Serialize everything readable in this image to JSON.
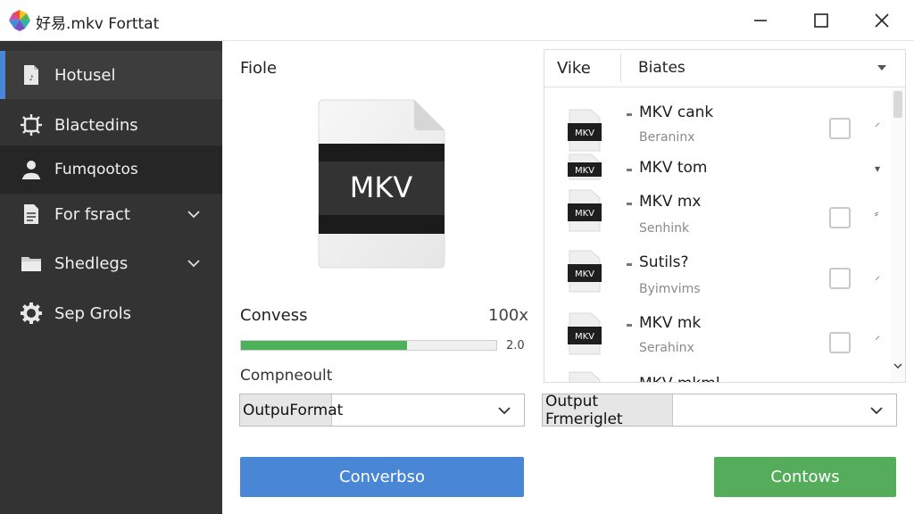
{
  "window": {
    "title": "好易.mkv Forttat",
    "icons": {
      "logo": "colorful-gem-logo",
      "minimize": "minimize-icon",
      "maximize": "maximize-icon",
      "close": "close-icon"
    }
  },
  "sidebar": {
    "items": [
      {
        "label": "Hotusel",
        "icon": "audio-file-icon",
        "active": true
      },
      {
        "label": "Blactedins",
        "icon": "chip-gear-icon"
      },
      {
        "label": "Fumqootos",
        "icon": "user-icon"
      },
      {
        "label": "For fsract",
        "icon": "document-icon",
        "expandable": true
      },
      {
        "label": "Shedlegs",
        "icon": "folder-icon",
        "expandable": true
      },
      {
        "label": "Sep Grols",
        "icon": "gear-icon"
      }
    ]
  },
  "main": {
    "file_label": "Fiole",
    "file_type": "MKV",
    "convert_label": "Convess",
    "convert_percent": "100x",
    "progress_value": 0.65,
    "progress_number": "2.0",
    "component_label": "Compneoult",
    "output_select_label": "OutpuFormat",
    "output_select_2_label": "Output Frmeriglet",
    "convert_button": "Converbso",
    "continue_button": "Contows"
  },
  "list": {
    "header_col1": "Vike",
    "header_col2": "Biates",
    "rows": [
      {
        "icon_label": "MKV",
        "title": "MKV cank",
        "subtitle": "Beraninx",
        "mark": "⸝"
      },
      {
        "icon_label": "MKV",
        "title": "MKV tom",
        "subtitle": "",
        "mark": "▾"
      },
      {
        "icon_label": "MKV",
        "title": "MKV mx",
        "subtitle": "Senhink",
        "mark": "⸗"
      },
      {
        "icon_label": "MKV",
        "title": "Sutils?",
        "subtitle": "Byimvims",
        "mark": "⸝"
      },
      {
        "icon_label": "MKV",
        "title": "MKV mk",
        "subtitle": "Serahinx",
        "mark": "⸍"
      },
      {
        "icon_label": "",
        "title": "MKV mkml",
        "subtitle": "",
        "mark": ""
      }
    ]
  },
  "colors": {
    "sidebar_bg": "#333333",
    "accent_blue": "#4a86d6",
    "accent_green": "#55ad5c",
    "progress_green": "#4cb25a"
  }
}
